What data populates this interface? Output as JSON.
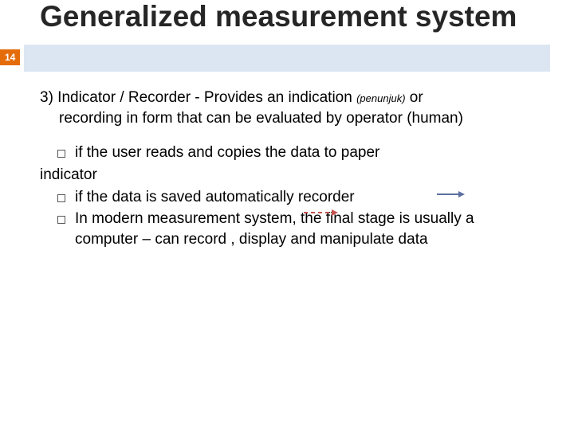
{
  "page_number": "14",
  "title": "Generalized measurement system",
  "para1_lead": "3) Indicator / Recorder - Provides an indication ",
  "para1_penunjuk": "(penunjuk)",
  "para1_tail": " or",
  "para1_line2": "recording in form that can be evaluated by operator (human)",
  "bullets": {
    "b1_text": "if the user reads and copies the data to paper",
    "b1_wrap": "indicator",
    "b2_text": "if the data is saved automatically           recorder",
    "b3_text": "In modern measurement system, the final stage is usually a computer – can record , display and manipulate data"
  }
}
